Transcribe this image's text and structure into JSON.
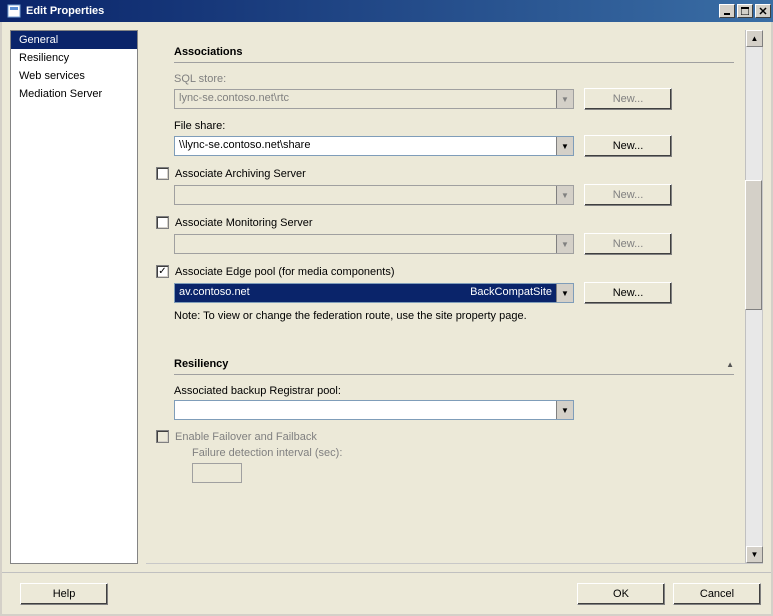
{
  "window": {
    "title": "Edit Properties"
  },
  "sidebar": {
    "items": [
      {
        "label": "General",
        "selected": true
      },
      {
        "label": "Resiliency",
        "selected": false
      },
      {
        "label": "Web services",
        "selected": false
      },
      {
        "label": "Mediation Server",
        "selected": false
      }
    ]
  },
  "sections": {
    "associations": {
      "heading": "Associations",
      "sql_store": {
        "label": "SQL store:",
        "value": "lync-se.contoso.net\\rtc",
        "new_btn": "New..."
      },
      "file_share": {
        "label": "File share:",
        "value": "\\\\lync-se.contoso.net\\share",
        "new_btn": "New..."
      },
      "archiving": {
        "check_label": "Associate Archiving Server",
        "checked": false,
        "value": "",
        "new_btn": "New..."
      },
      "monitoring": {
        "check_label": "Associate Monitoring Server",
        "checked": false,
        "value": "",
        "new_btn": "New..."
      },
      "edge": {
        "check_label": "Associate Edge pool (for media components)",
        "checked": true,
        "value_left": "av.contoso.net",
        "value_right": "BackCompatSite",
        "new_btn": "New...",
        "note": "Note: To view or change the federation route, use the site property page."
      }
    },
    "resiliency": {
      "heading": "Resiliency",
      "backup_pool": {
        "label": "Associated backup Registrar pool:",
        "value": ""
      },
      "failover": {
        "check_label": "Enable Failover and Failback",
        "checked": false,
        "interval_label": "Failure detection interval (sec):",
        "interval_value": ""
      }
    }
  },
  "footer": {
    "help": "Help",
    "ok": "OK",
    "cancel": "Cancel"
  }
}
